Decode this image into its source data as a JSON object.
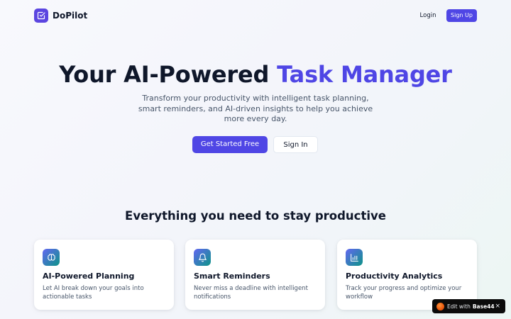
{
  "header": {
    "brand": "DoPilot",
    "login_label": "Login",
    "signup_label": "Sign Up"
  },
  "hero": {
    "title_part1": "Your AI-Powered ",
    "title_accent": "Task Manager",
    "subtitle": "Transform your productivity with intelligent task planning, smart reminders, and AI-driven insights to help you achieve more every day.",
    "primary_cta": "Get Started Free",
    "secondary_cta": "Sign In"
  },
  "features": {
    "heading": "Everything you need to stay productive",
    "cards": [
      {
        "icon": "brain-icon",
        "title": "AI-Powered Planning",
        "description": "Let AI break down your goals into actionable tasks"
      },
      {
        "icon": "bell-icon",
        "title": "Smart Reminders",
        "description": "Never miss a deadline with intelligent notifications"
      },
      {
        "icon": "bar-chart-icon",
        "title": "Productivity Analytics",
        "description": "Track your progress and optimize your workflow"
      }
    ]
  },
  "badge": {
    "text": "Edit with",
    "brand": "Base44",
    "close": "×"
  },
  "colors": {
    "accent": "#4f46e5",
    "logo": "#5b45e0",
    "icon_gradient_start": "#6366f1",
    "icon_gradient_end": "#0d9488"
  }
}
